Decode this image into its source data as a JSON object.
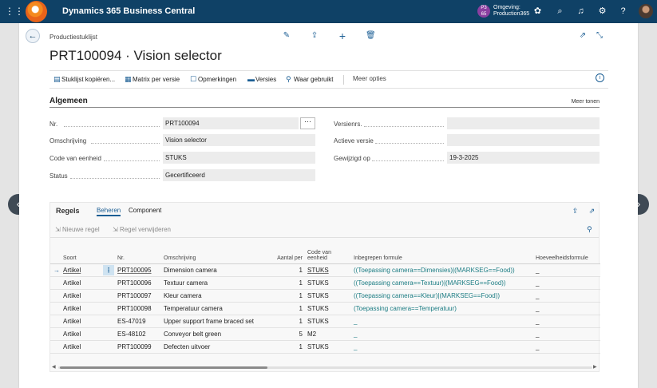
{
  "app": {
    "title": "Dynamics 365 Business Central",
    "env_badge": "P3\n65",
    "env_label": "Omgeving:",
    "env_name": "Production365"
  },
  "page": {
    "breadcrumb": "Productiestuklijst",
    "title": "PRT100094 · Vision selector"
  },
  "actions": {
    "copy": "Stuklijst kopiëren...",
    "matrix": "Matrix per versie",
    "comments": "Opmerkingen",
    "versions": "Versies",
    "where_used": "Waar gebruikt",
    "more": "Meer opties"
  },
  "general": {
    "title": "Algemeen",
    "show_more": "Meer tonen",
    "no_label": "Nr.",
    "no_value": "PRT100094",
    "desc_label": "Omschrijving",
    "desc_value": "Vision selector",
    "uom_label": "Code van eenheid",
    "uom_value": "STUKS",
    "status_label": "Status",
    "status_value": "Gecertificeerd",
    "versions_label": "Versienrs.",
    "versions_value": "",
    "active_label": "Actieve versie",
    "active_value": "",
    "modified_label": "Gewijzigd op",
    "modified_value": "19-3-2025"
  },
  "lines": {
    "title": "Regels",
    "tab_manage": "Beheren",
    "tab_component": "Component",
    "new_line": "Nieuwe regel",
    "delete_line": "Regel verwijderen",
    "columns": {
      "type": "Soort",
      "no": "Nr.",
      "desc": "Omschrijving",
      "qty": "Aantal per",
      "uom_a": "Code van",
      "uom_b": "eenheid",
      "formula": "Inbegrepen formule",
      "qty_formula": "Hoeveelheidsformule"
    },
    "rows": [
      {
        "type": "Artikel",
        "no": "PRT100095",
        "desc": "Dimension camera",
        "qty": "1",
        "uom": "STUKS",
        "formula": "((Toepassing camera==Dimensies)|(MARKSEG==Food))",
        "qty_formula": "_"
      },
      {
        "type": "Artikel",
        "no": "PRT100096",
        "desc": "Textuur camera",
        "qty": "1",
        "uom": "STUKS",
        "formula": "((Toepassing camera==Textuur)|(MARKSEG==Food))",
        "qty_formula": "_"
      },
      {
        "type": "Artikel",
        "no": "PRT100097",
        "desc": "Kleur camera",
        "qty": "1",
        "uom": "STUKS",
        "formula": "((Toepassing camera==Kleur)|(MARKSEG==Food))",
        "qty_formula": "_"
      },
      {
        "type": "Artikel",
        "no": "PRT100098",
        "desc": "Temperatuur camera",
        "qty": "1",
        "uom": "STUKS",
        "formula": "(Toepassing camera==Temperatuur)",
        "qty_formula": "_"
      },
      {
        "type": "Artikel",
        "no": "ES-47019",
        "desc": "Upper support frame braced set",
        "qty": "1",
        "uom": "STUKS",
        "formula": "_",
        "qty_formula": "_"
      },
      {
        "type": "Artikel",
        "no": "ES-48102",
        "desc": "Conveyor belt green",
        "qty": "5",
        "uom": "M2",
        "formula": "_",
        "qty_formula": "_"
      },
      {
        "type": "Artikel",
        "no": "PRT100099",
        "desc": "Defecten uitvoer",
        "qty": "1",
        "uom": "STUKS",
        "formula": "_",
        "qty_formula": "_"
      }
    ]
  },
  "colors": {
    "topbar": "#0f4166",
    "accent": "#1b5e94",
    "formula": "#1b7c83"
  }
}
